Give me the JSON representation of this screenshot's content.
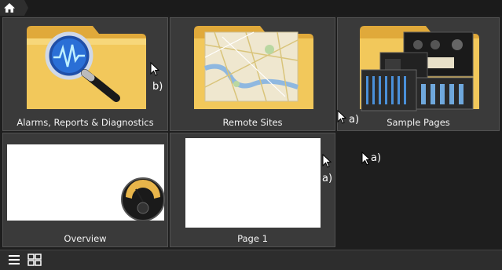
{
  "breadcrumb": {
    "home_icon": "home-icon"
  },
  "tiles": [
    {
      "label": "Alarms, Reports & Diagnostics",
      "icon": "magnifier-pulse-folder"
    },
    {
      "label": "Remote Sites",
      "icon": "map-folder"
    },
    {
      "label": "Sample Pages",
      "icon": "equipment-folder"
    },
    {
      "label": "Overview",
      "icon": "gauge-page-thumbnail"
    },
    {
      "label": "Page 1",
      "icon": "blank-page-thumbnail"
    }
  ],
  "annotations": {
    "b": "b)",
    "a1": "a)",
    "a2": "a)",
    "a3": "a)"
  },
  "bottombar": {
    "list_view_icon": "list-view-icon",
    "grid_view_icon": "grid-view-icon"
  },
  "colors": {
    "folder": "#f2c85b",
    "tile_bg": "#3a3a3a",
    "page_bg": "#1e1e1e"
  }
}
